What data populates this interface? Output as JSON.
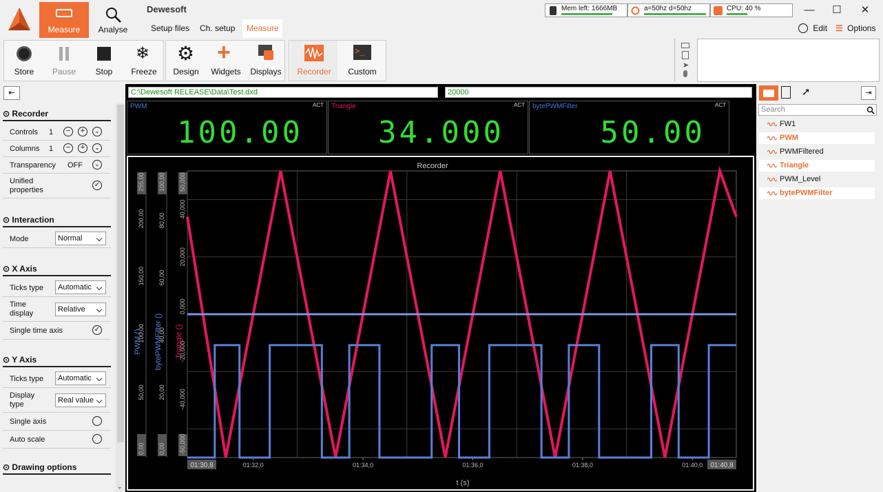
{
  "app": {
    "title": "Dewesoft"
  },
  "main_tabs": [
    {
      "label": "Measure"
    },
    {
      "label": "Analyse"
    }
  ],
  "sub_tabs": [
    {
      "label": "Setup files"
    },
    {
      "label": "Ch. setup"
    },
    {
      "label": "Measure"
    }
  ],
  "status": {
    "mem": "Mem left: 1666MB",
    "sync": "a=50hz d=50hz",
    "cpu": "CPU: 40 %"
  },
  "top_right": {
    "edit": "Edit",
    "options": "Options"
  },
  "toolbar": [
    {
      "label": "Store"
    },
    {
      "label": "Pause"
    },
    {
      "label": "Stop"
    },
    {
      "label": "Freeze"
    },
    {
      "label": "Design"
    },
    {
      "label": "Widgets"
    },
    {
      "label": "Displays"
    },
    {
      "label": "Recorder"
    },
    {
      "label": "Custom"
    }
  ],
  "file_path": "C:\\Dewesoft RELEASE\\Data\\Test.dxd",
  "sample_rate": "20000",
  "digital_meters": [
    {
      "name": "PWM",
      "act": "ACT",
      "value": "100.00"
    },
    {
      "name": "Triangle",
      "act": "ACT",
      "value": "34.000"
    },
    {
      "name": "bytePWMFilter",
      "act": "ACT",
      "value": "50.00"
    }
  ],
  "sidebar": {
    "recorder": "Recorder",
    "controls_label": "Controls",
    "controls_val": "1",
    "columns_label": "Columns",
    "columns_val": "1",
    "transparency_label": "Transparency",
    "transparency_val": "OFF",
    "unified_label": "Unified properties",
    "interaction": "Interaction",
    "mode_label": "Mode",
    "mode_val": "Normal",
    "xaxis": "X Axis",
    "xticks_label": "Ticks type",
    "xticks_val": "Automatic",
    "time_display_label": "Time display",
    "time_display_val": "Relative",
    "single_time_label": "Single time axis",
    "yaxis": "Y Axis",
    "yticks_label": "Ticks type",
    "yticks_val": "Automatic",
    "display_type_label": "Display type",
    "display_type_val": "Real value",
    "single_axis_label": "Single axis",
    "auto_scale_label": "Auto scale",
    "drawing": "Drawing options"
  },
  "channels": {
    "search_placeholder": "Search",
    "items": [
      {
        "name": "FW1",
        "selected": false
      },
      {
        "name": "PWM",
        "selected": true
      },
      {
        "name": "PWMFiltered",
        "selected": false
      },
      {
        "name": "Triangle",
        "selected": true
      },
      {
        "name": "PWM_Level",
        "selected": false
      },
      {
        "name": "bytePWMFilter",
        "selected": true
      }
    ]
  },
  "chart_data": {
    "type": "line",
    "title": "Recorder",
    "xlabel": "t (s)",
    "x_ticks": [
      "01:32,0",
      "01:34,0",
      "01:36,0",
      "01:38,0",
      "01:40,0"
    ],
    "x_start": "01:30,8",
    "x_end": "01:40,8",
    "xlim": [
      90.8,
      100.8
    ],
    "axes": [
      {
        "label": "PWM ()",
        "ticks": [
          "0,00",
          "50,00",
          "100,00",
          "150,00",
          "200,00",
          "255,00"
        ],
        "ylim": [
          0,
          255
        ],
        "color": "#5a7fd8"
      },
      {
        "label": "bytePWMFilter ()",
        "ticks": [
          "0,00",
          "20,00",
          "40,00",
          "60,00",
          "80,00",
          "100,00"
        ],
        "ylim": [
          0,
          100
        ],
        "color": "#5a7fd8"
      },
      {
        "label": "Triangle ()",
        "ticks": [
          "-50,000",
          "-40,000",
          "-20,000",
          "0,000",
          "20,000",
          "40,000",
          "50,000"
        ],
        "ylim": [
          -50,
          50
        ],
        "color": "#e0195a"
      }
    ],
    "series": [
      {
        "name": "Triangle",
        "color": "#e0195a",
        "x": [
          90.8,
          91.5,
          92.5,
          93.5,
          94.5,
          95.5,
          96.5,
          97.5,
          98.5,
          99.5,
          100.5,
          100.8
        ],
        "y": [
          34,
          -50,
          50,
          -50,
          50,
          -50,
          50,
          -50,
          50,
          -50,
          50,
          34
        ]
      },
      {
        "name": "PWM",
        "color": "#5a7fd8",
        "x": [
          90.8,
          91.3,
          91.3,
          91.75,
          91.75,
          92.3,
          92.3,
          93.25,
          93.25,
          93.75,
          93.75,
          94.3,
          94.3,
          95.25,
          95.25,
          95.75,
          95.75,
          96.3,
          96.3,
          97.25,
          97.25,
          97.75,
          97.75,
          98.3,
          98.3,
          99.25,
          99.25,
          99.75,
          99.75,
          100.3,
          100.3,
          100.8
        ],
        "y": [
          0,
          0,
          100,
          100,
          0,
          0,
          100,
          100,
          0,
          0,
          100,
          100,
          0,
          0,
          100,
          100,
          0,
          0,
          100,
          100,
          0,
          0,
          100,
          100,
          0,
          0,
          100,
          100,
          0,
          0,
          100,
          100
        ]
      },
      {
        "name": "bytePWMFilter",
        "color": "#7b96e0",
        "x": [
          90.8,
          100.8
        ],
        "y": [
          50,
          50
        ]
      }
    ],
    "grid": true
  }
}
